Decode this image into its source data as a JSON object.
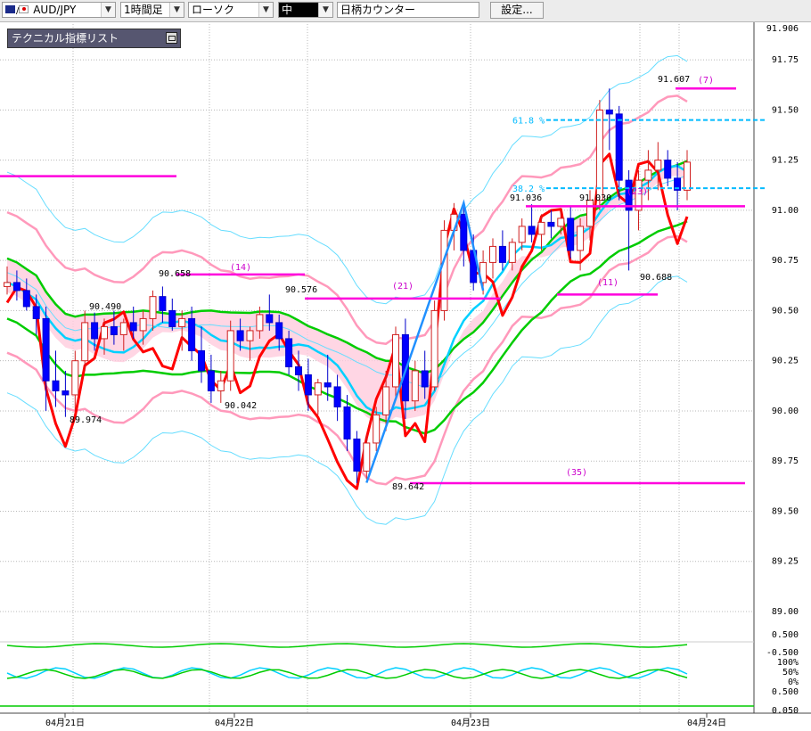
{
  "toolbar": {
    "symbol": "AUD/JPY",
    "timeframe": "1時間足",
    "chart_kind": "ローソク",
    "size": "中",
    "counter": "日柄カウンター",
    "settings": "設定..."
  },
  "panel": {
    "title": "テクニカル指標リスト"
  },
  "colors": {
    "up_candle": "#e0e0ff",
    "down_candle": "#0000ff",
    "red_line": "#ff0000",
    "green_line": "#00cc00",
    "pink_line": "#ff99bb",
    "cyan_line": "#00d0ff",
    "thin_cyan": "#66ddff",
    "magenta": "#ff00dd",
    "cloud_pink": "#ffccdd",
    "cloud_blue": "#cce4ff",
    "fib": "#00bbff"
  },
  "chart_data": {
    "type": "candlestick",
    "y_axis": {
      "ticks": [
        "91.906",
        "91.75",
        "91.50",
        "91.25",
        "91.00",
        "90.75",
        "90.50",
        "90.25",
        "90.00",
        "89.75",
        "89.50",
        "89.25",
        "89.00"
      ],
      "range": [
        89.0,
        91.906
      ]
    },
    "x_axis": {
      "labels": [
        "04月21日",
        "04月22日",
        "04月23日",
        "04月24日"
      ]
    },
    "price_labels": [
      "91.607",
      "91.036",
      "91.030",
      "90.688",
      "90.658",
      "90.576",
      "90.490",
      "90.042",
      "89.974",
      "89.642"
    ],
    "count_labels": [
      "(7)",
      "(14)",
      "(21)",
      "(23)",
      "(11)",
      "(35)"
    ],
    "fib_labels": [
      "61.8 %",
      "38.2 %"
    ],
    "oscillator_ticks": [
      "0.500",
      "-0.500",
      "100%",
      "50%",
      "0%",
      "0.500",
      "0.050"
    ],
    "candles": [
      {
        "o": 90.62,
        "h": 90.72,
        "l": 90.58,
        "c": 90.64
      },
      {
        "o": 90.64,
        "h": 90.7,
        "l": 90.55,
        "c": 90.6
      },
      {
        "o": 90.6,
        "h": 90.66,
        "l": 90.5,
        "c": 90.52
      },
      {
        "o": 90.52,
        "h": 90.58,
        "l": 90.38,
        "c": 90.46
      },
      {
        "o": 90.46,
        "h": 90.52,
        "l": 90.0,
        "c": 90.15
      },
      {
        "o": 90.15,
        "h": 90.3,
        "l": 90.02,
        "c": 90.1
      },
      {
        "o": 90.1,
        "h": 90.2,
        "l": 89.97,
        "c": 90.08
      },
      {
        "o": 90.08,
        "h": 90.3,
        "l": 90.0,
        "c": 90.25
      },
      {
        "o": 90.25,
        "h": 90.5,
        "l": 90.2,
        "c": 90.44
      },
      {
        "o": 90.44,
        "h": 90.49,
        "l": 90.3,
        "c": 90.36
      },
      {
        "o": 90.36,
        "h": 90.46,
        "l": 90.28,
        "c": 90.42
      },
      {
        "o": 90.42,
        "h": 90.5,
        "l": 90.33,
        "c": 90.38
      },
      {
        "o": 90.38,
        "h": 90.46,
        "l": 90.3,
        "c": 90.44
      },
      {
        "o": 90.44,
        "h": 90.52,
        "l": 90.36,
        "c": 90.4
      },
      {
        "o": 90.4,
        "h": 90.5,
        "l": 90.33,
        "c": 90.46
      },
      {
        "o": 90.46,
        "h": 90.6,
        "l": 90.4,
        "c": 90.57
      },
      {
        "o": 90.57,
        "h": 90.62,
        "l": 90.44,
        "c": 90.5
      },
      {
        "o": 90.5,
        "h": 90.56,
        "l": 90.4,
        "c": 90.42
      },
      {
        "o": 90.42,
        "h": 90.5,
        "l": 90.3,
        "c": 90.46
      },
      {
        "o": 90.46,
        "h": 90.52,
        "l": 90.25,
        "c": 90.3
      },
      {
        "o": 90.3,
        "h": 90.42,
        "l": 90.14,
        "c": 90.2
      },
      {
        "o": 90.2,
        "h": 90.28,
        "l": 90.04,
        "c": 90.1
      },
      {
        "o": 90.1,
        "h": 90.2,
        "l": 90.04,
        "c": 90.15
      },
      {
        "o": 90.15,
        "h": 90.45,
        "l": 90.1,
        "c": 90.4
      },
      {
        "o": 90.4,
        "h": 90.46,
        "l": 90.3,
        "c": 90.35
      },
      {
        "o": 90.35,
        "h": 90.42,
        "l": 90.25,
        "c": 90.4
      },
      {
        "o": 90.4,
        "h": 90.52,
        "l": 90.36,
        "c": 90.48
      },
      {
        "o": 90.48,
        "h": 90.58,
        "l": 90.4,
        "c": 90.44
      },
      {
        "o": 90.44,
        "h": 90.48,
        "l": 90.3,
        "c": 90.36
      },
      {
        "o": 90.36,
        "h": 90.4,
        "l": 90.18,
        "c": 90.22
      },
      {
        "o": 90.22,
        "h": 90.3,
        "l": 90.1,
        "c": 90.18
      },
      {
        "o": 90.18,
        "h": 90.26,
        "l": 90.0,
        "c": 90.08
      },
      {
        "o": 90.08,
        "h": 90.16,
        "l": 89.98,
        "c": 90.14
      },
      {
        "o": 90.14,
        "h": 90.28,
        "l": 90.05,
        "c": 90.12
      },
      {
        "o": 90.12,
        "h": 90.18,
        "l": 89.95,
        "c": 90.02
      },
      {
        "o": 90.02,
        "h": 90.08,
        "l": 89.8,
        "c": 89.86
      },
      {
        "o": 89.86,
        "h": 89.9,
        "l": 89.64,
        "c": 89.7
      },
      {
        "o": 89.7,
        "h": 89.88,
        "l": 89.66,
        "c": 89.84
      },
      {
        "o": 89.84,
        "h": 90.02,
        "l": 89.8,
        "c": 89.98
      },
      {
        "o": 89.98,
        "h": 90.2,
        "l": 89.9,
        "c": 90.12
      },
      {
        "o": 90.12,
        "h": 90.42,
        "l": 90.05,
        "c": 90.38
      },
      {
        "o": 90.38,
        "h": 90.46,
        "l": 89.96,
        "c": 90.05
      },
      {
        "o": 90.05,
        "h": 90.25,
        "l": 90.0,
        "c": 90.2
      },
      {
        "o": 90.2,
        "h": 90.3,
        "l": 90.06,
        "c": 90.12
      },
      {
        "o": 90.12,
        "h": 90.55,
        "l": 90.1,
        "c": 90.5
      },
      {
        "o": 90.5,
        "h": 90.95,
        "l": 90.45,
        "c": 90.9
      },
      {
        "o": 90.9,
        "h": 91.036,
        "l": 90.8,
        "c": 90.98
      },
      {
        "o": 90.98,
        "h": 91.02,
        "l": 90.72,
        "c": 90.8
      },
      {
        "o": 90.8,
        "h": 90.88,
        "l": 90.6,
        "c": 90.64
      },
      {
        "o": 90.64,
        "h": 90.8,
        "l": 90.58,
        "c": 90.74
      },
      {
        "o": 90.74,
        "h": 90.86,
        "l": 90.66,
        "c": 90.82
      },
      {
        "o": 90.82,
        "h": 90.9,
        "l": 90.7,
        "c": 90.74
      },
      {
        "o": 90.74,
        "h": 90.86,
        "l": 90.7,
        "c": 90.84
      },
      {
        "o": 90.84,
        "h": 90.96,
        "l": 90.8,
        "c": 90.92
      },
      {
        "o": 90.92,
        "h": 91.03,
        "l": 90.84,
        "c": 90.88
      },
      {
        "o": 90.88,
        "h": 90.98,
        "l": 90.8,
        "c": 90.94
      },
      {
        "o": 90.94,
        "h": 91.0,
        "l": 90.86,
        "c": 90.92
      },
      {
        "o": 90.92,
        "h": 91.0,
        "l": 90.88,
        "c": 90.96
      },
      {
        "o": 90.96,
        "h": 91.02,
        "l": 90.76,
        "c": 90.8
      },
      {
        "o": 90.8,
        "h": 90.96,
        "l": 90.7,
        "c": 90.92
      },
      {
        "o": 90.92,
        "h": 91.1,
        "l": 90.85,
        "c": 91.05
      },
      {
        "o": 91.05,
        "h": 91.55,
        "l": 91.0,
        "c": 91.5
      },
      {
        "o": 91.5,
        "h": 91.607,
        "l": 91.3,
        "c": 91.48
      },
      {
        "o": 91.48,
        "h": 91.52,
        "l": 91.05,
        "c": 91.15
      },
      {
        "o": 91.15,
        "h": 91.2,
        "l": 90.7,
        "c": 91.0
      },
      {
        "o": 91.0,
        "h": 91.2,
        "l": 90.9,
        "c": 91.15
      },
      {
        "o": 91.15,
        "h": 91.3,
        "l": 91.05,
        "c": 91.2
      },
      {
        "o": 91.2,
        "h": 91.34,
        "l": 91.1,
        "c": 91.25
      },
      {
        "o": 91.25,
        "h": 91.3,
        "l": 91.12,
        "c": 91.16
      },
      {
        "o": 91.16,
        "h": 91.24,
        "l": 91.0,
        "c": 91.1
      },
      {
        "o": 91.1,
        "h": 91.3,
        "l": 91.05,
        "c": 91.24
      }
    ]
  }
}
